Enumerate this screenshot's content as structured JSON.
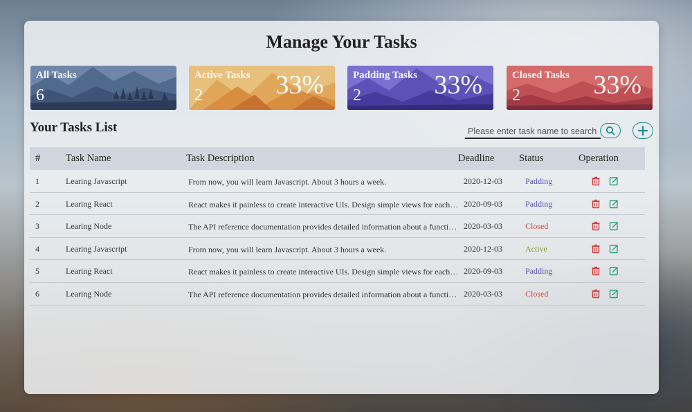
{
  "title": "Manage Your Tasks",
  "cards": [
    {
      "label": "All Tasks",
      "count": "6",
      "percent": "",
      "theme": "slate"
    },
    {
      "label": "Active Tasks",
      "count": "2",
      "percent": "33%",
      "theme": "amber"
    },
    {
      "label": "Padding Tasks",
      "count": "2",
      "percent": "33%",
      "theme": "violet"
    },
    {
      "label": "Closed Tasks",
      "count": "2",
      "percent": "33%",
      "theme": "crimson"
    }
  ],
  "list_title": "Your Tasks List",
  "search": {
    "placeholder": "Please enter task name to search",
    "value": ""
  },
  "table": {
    "headers": {
      "num": "#",
      "name": "Task Name",
      "desc": "Task Description",
      "deadline": "Deadline",
      "status": "Status",
      "operation": "Operation"
    },
    "rows": [
      {
        "num": "1",
        "name": "Learing Javascript",
        "desc": "From now, you will learn Javascript. About 3 hours a week.",
        "deadline": "2020-12-03",
        "status": "Padding"
      },
      {
        "num": "2",
        "name": "Learing React",
        "desc": "React makes it painless to create interactive UIs. Design simple views for each state in your application.",
        "deadline": "2020-09-03",
        "status": "Padding"
      },
      {
        "num": "3",
        "name": "Learing Node",
        "desc": "The API reference documentation provides detailed information about a function or object in Node.js.",
        "deadline": "2020-03-03",
        "status": "Closed"
      },
      {
        "num": "4",
        "name": "Learing Javascript",
        "desc": "From now, you will learn Javascript. About 3 hours a week.",
        "deadline": "2020-12-03",
        "status": "Active"
      },
      {
        "num": "5",
        "name": "Learing React",
        "desc": "React makes it painless to create interactive UIs. Design simple views for each state in your application.",
        "deadline": "2020-09-03",
        "status": "Padding"
      },
      {
        "num": "6",
        "name": "Learing Node",
        "desc": "The API reference documentation provides detailed information about a function or object in Node.js.",
        "deadline": "2020-03-03",
        "status": "Closed"
      }
    ]
  },
  "status_colors": {
    "Padding": "#5a55b0",
    "Closed": "#cc4a4a",
    "Active": "#8c9a2a"
  },
  "icons": {
    "search": "search-icon",
    "add": "plus-icon",
    "delete": "trash-icon",
    "edit": "edit-icon"
  },
  "colors": {
    "accent": "#1d8a8a",
    "delete": "#d23b3b",
    "edit": "#2aa27a"
  }
}
